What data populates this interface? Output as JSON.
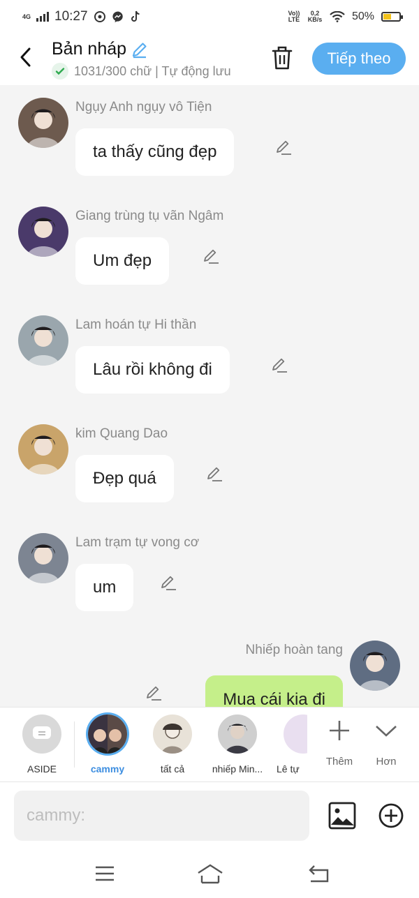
{
  "status_bar": {
    "network": "4G",
    "time": "10:27",
    "volte": "Vo)) LTE",
    "speed": "0,2 KB/s",
    "battery": "50%",
    "battery_level": 0.5
  },
  "header": {
    "title": "Bản nháp",
    "subtitle": "1031/300 chữ | Tự động lưu",
    "next_button": "Tiếp theo"
  },
  "messages": [
    {
      "name": "Ngụy Anh ngụy vô Tiện",
      "text": "ta thấy cũng đẹp",
      "avatar_bg": "#6d5a4e"
    },
    {
      "name": "Giang trùng tụ vãn Ngâm",
      "text": "Um đẹp",
      "avatar_bg": "#4a3a6a"
    },
    {
      "name": "Lam hoán tự Hi thần",
      "text": "Lâu rồi không đi",
      "avatar_bg": "#9aa6ad"
    },
    {
      "name": "kim Quang Dao",
      "text": "Đẹp quá",
      "avatar_bg": "#c9a46a"
    },
    {
      "name": "Lam trạm tự vong cơ",
      "text": "um",
      "avatar_bg": "#7d8592"
    },
    {
      "name": "Nhiếp hoàn tang",
      "text": "Mua cái kia đi",
      "avatar_bg": "#5f6d82",
      "mine": true
    }
  ],
  "characters": [
    {
      "label": "ASIDE"
    },
    {
      "label": "cammy",
      "active": true
    },
    {
      "label": "tất cả"
    },
    {
      "label": "nhiếp Min..."
    },
    {
      "label": "Lê tự"
    }
  ],
  "tools": {
    "add_label": "Thêm",
    "more_label": "Hơn"
  },
  "input": {
    "placeholder": "cammy:"
  },
  "colors": {
    "accent": "#5aaef0",
    "my_bubble": "#c5ef8a",
    "background": "#f4f4f4"
  }
}
